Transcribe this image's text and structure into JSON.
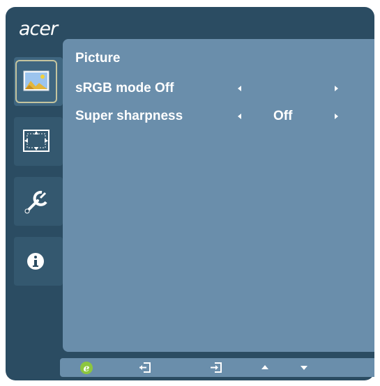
{
  "brand": {
    "logo": "acer"
  },
  "sidebar": {
    "items": [
      {
        "name": "picture",
        "icon": "picture-icon",
        "active": true
      },
      {
        "name": "position",
        "icon": "position-icon",
        "active": false
      },
      {
        "name": "setup",
        "icon": "wrench-icon",
        "active": false
      },
      {
        "name": "information",
        "icon": "info-icon",
        "active": false
      }
    ]
  },
  "menu": {
    "title": "Picture",
    "items": [
      {
        "label": "sRGB mode Off",
        "value": ""
      },
      {
        "label": "Super sharpness",
        "value": "Off"
      }
    ]
  },
  "bottom_bar": {
    "buttons": [
      {
        "name": "empowering-key",
        "icon": "e-icon"
      },
      {
        "name": "exit",
        "icon": "exit-icon"
      },
      {
        "name": "enter",
        "icon": "enter-icon"
      },
      {
        "name": "up",
        "icon": "triangle-up-icon"
      },
      {
        "name": "down",
        "icon": "triangle-down-icon"
      }
    ]
  },
  "colors": {
    "frame": "#2b4c62",
    "panel": "#6a8eab",
    "text": "#ffffff",
    "accent_green": "#8cc63f"
  }
}
